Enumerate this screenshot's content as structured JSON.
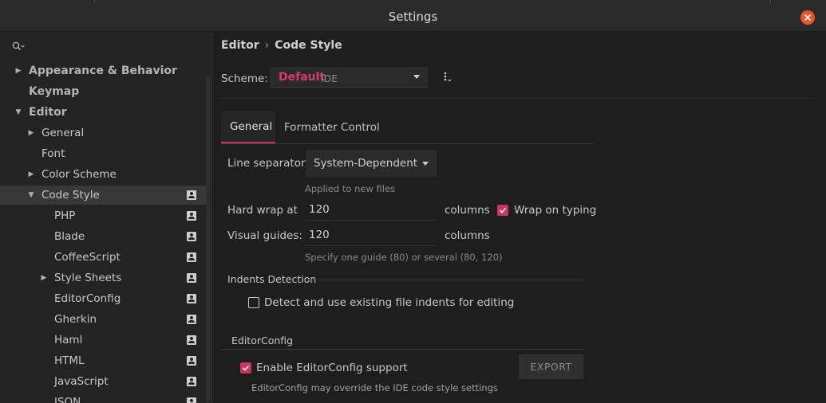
{
  "window": {
    "title": "Settings"
  },
  "breadcrumb": {
    "parent": "Editor",
    "separator": "›",
    "current": "Code Style"
  },
  "scheme": {
    "label": "Scheme:",
    "name": "Default",
    "sub": "IDE"
  },
  "sidebar": {
    "items": [
      {
        "label": "Appearance & Behavior",
        "level": 0,
        "arrow": "right",
        "scope": false,
        "selected": false
      },
      {
        "label": "Keymap",
        "level": 0,
        "arrow": "none",
        "scope": false,
        "selected": false
      },
      {
        "label": "Editor",
        "level": 0,
        "arrow": "down",
        "scope": false,
        "selected": false
      },
      {
        "label": "General",
        "level": 1,
        "arrow": "right",
        "scope": false,
        "selected": false
      },
      {
        "label": "Font",
        "level": 1,
        "arrow": "none",
        "scope": false,
        "selected": false
      },
      {
        "label": "Color Scheme",
        "level": 1,
        "arrow": "right",
        "scope": false,
        "selected": false
      },
      {
        "label": "Code Style",
        "level": 1,
        "arrow": "down",
        "scope": true,
        "selected": true
      },
      {
        "label": "PHP",
        "level": 2,
        "arrow": "none",
        "scope": true,
        "selected": false
      },
      {
        "label": "Blade",
        "level": 2,
        "arrow": "none",
        "scope": true,
        "selected": false
      },
      {
        "label": "CoffeeScript",
        "level": 2,
        "arrow": "none",
        "scope": true,
        "selected": false
      },
      {
        "label": "Style Sheets",
        "level": 2,
        "arrow": "right",
        "scope": true,
        "selected": false
      },
      {
        "label": "EditorConfig",
        "level": 2,
        "arrow": "none",
        "scope": true,
        "selected": false
      },
      {
        "label": "Gherkin",
        "level": 2,
        "arrow": "none",
        "scope": true,
        "selected": false
      },
      {
        "label": "Haml",
        "level": 2,
        "arrow": "none",
        "scope": true,
        "selected": false
      },
      {
        "label": "HTML",
        "level": 2,
        "arrow": "none",
        "scope": true,
        "selected": false
      },
      {
        "label": "JavaScript",
        "level": 2,
        "arrow": "none",
        "scope": true,
        "selected": false
      },
      {
        "label": "JSON",
        "level": 2,
        "arrow": "none",
        "scope": true,
        "selected": false
      }
    ]
  },
  "tabs": [
    {
      "label": "General",
      "active": true
    },
    {
      "label": "Formatter Control",
      "active": false
    }
  ],
  "general": {
    "line_separator_label": "Line separator:",
    "line_separator_value": "System-Dependent",
    "line_separator_hint": "Applied to new files",
    "hard_wrap_label": "Hard wrap at",
    "hard_wrap_value": "120",
    "hard_wrap_unit": "columns",
    "wrap_on_typing_label": "Wrap on typing",
    "wrap_on_typing_checked": true,
    "visual_guides_label": "Visual guides:",
    "visual_guides_value": "120",
    "visual_guides_unit": "columns",
    "visual_guides_hint": "Specify one guide (80) or several (80, 120)"
  },
  "indents": {
    "section_title": "Indents Detection",
    "detect_label": "Detect and use existing file indents for editing",
    "detect_checked": false
  },
  "editorconfig": {
    "section_title": "EditorConfig",
    "enable_label": "Enable EditorConfig support",
    "enable_checked": true,
    "export_label": "EXPORT",
    "hint": "EditorConfig may override the IDE code style settings"
  },
  "colors": {
    "accent": "#c7365f",
    "scheme_name": "#d63b6b",
    "close": "#e9542c"
  }
}
